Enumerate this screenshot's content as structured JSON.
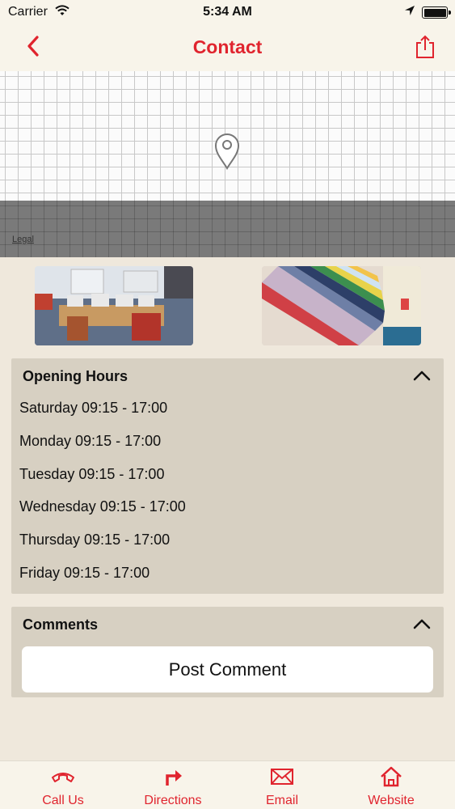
{
  "status_bar": {
    "carrier": "Carrier",
    "time": "5:34 AM"
  },
  "nav": {
    "title": "Contact",
    "back_icon": "chevron-left-icon",
    "share_icon": "share-icon"
  },
  "map": {
    "legal": "Legal"
  },
  "opening_hours": {
    "title": "Opening Hours",
    "rows": [
      "Saturday 09:15 - 17:00",
      "Monday 09:15 - 17:00",
      "Tuesday 09:15 - 17:00",
      "Wednesday 09:15 - 17:00",
      "Thursday 09:15 - 17:00",
      "Friday 09:15 - 17:00"
    ]
  },
  "comments": {
    "title": "Comments",
    "post_button": "Post Comment"
  },
  "tabbar": {
    "items": [
      {
        "label": "Call Us",
        "icon": "phone-icon"
      },
      {
        "label": "Directions",
        "icon": "directions-icon"
      },
      {
        "label": "Email",
        "icon": "email-icon"
      },
      {
        "label": "Website",
        "icon": "home-icon"
      }
    ]
  },
  "colors": {
    "accent": "#e0242e",
    "background": "#efe8dc",
    "card": "#d7d0c2"
  }
}
